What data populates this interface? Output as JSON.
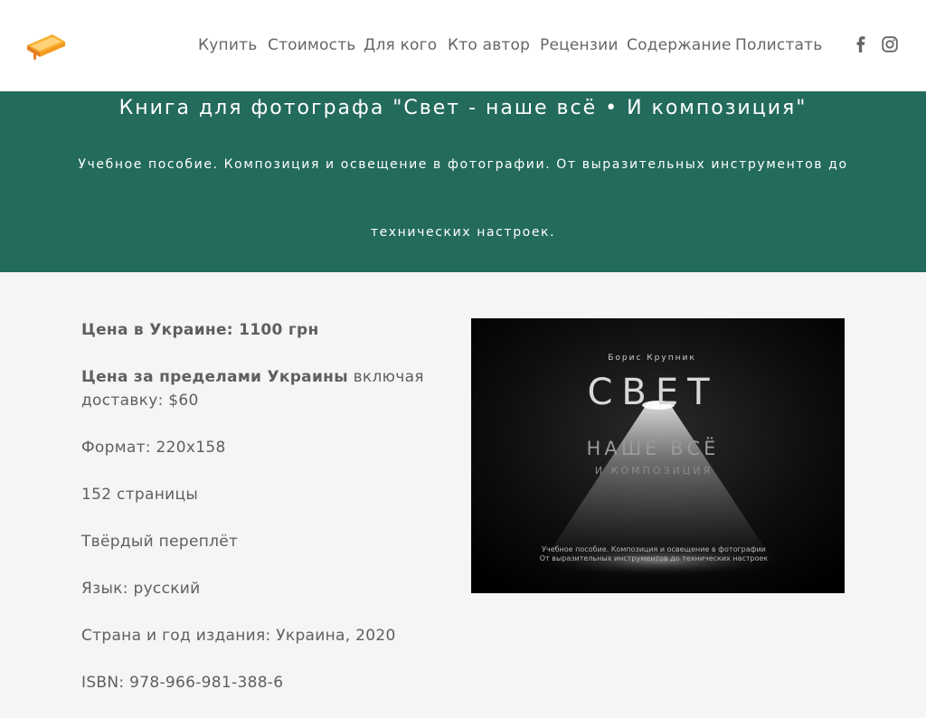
{
  "nav": {
    "items": [
      "Купить",
      "Стоимость",
      "Для кого",
      "Кто автор",
      "Рецензии",
      "Содержание",
      "Полистать"
    ],
    "social": [
      "facebook-icon",
      "instagram-icon"
    ]
  },
  "hero": {
    "title": "Книга для фотографа \"Свет - наше всё • И композиция\"",
    "subtitle_line1": "Учебное пособие. Композиция и освещение в фотографии. От выразительных инструментов до",
    "subtitle_line2": "технических настроек."
  },
  "details": {
    "price_ua_label": "Цена в Украине: 1100 грн",
    "price_abroad_label": "Цена за пределами Украины",
    "price_abroad_rest": " включая доставку: $60",
    "format": "Формат: 220х158",
    "pages": "152 страницы",
    "binding": "Твёрдый переплёт",
    "language": "Язык: русский",
    "country_year": "Страна и год издания: Украина, 2020",
    "isbn": "ISBN: 978-966-981-388-6"
  },
  "cover": {
    "author": "Борис Крупник",
    "title": "СВЕТ",
    "subtitle": "НАШЕ ВСЁ",
    "subtitle2": "И КОМПОЗИЦИЯ",
    "caption_line1": "Учебное пособие. Композиция и освещение в фотографии",
    "caption_line2": "От выразительных инструментов до технических настроек"
  },
  "colors": {
    "hero_bg": "#236b5c",
    "logo_orange": "#f39a1f"
  }
}
